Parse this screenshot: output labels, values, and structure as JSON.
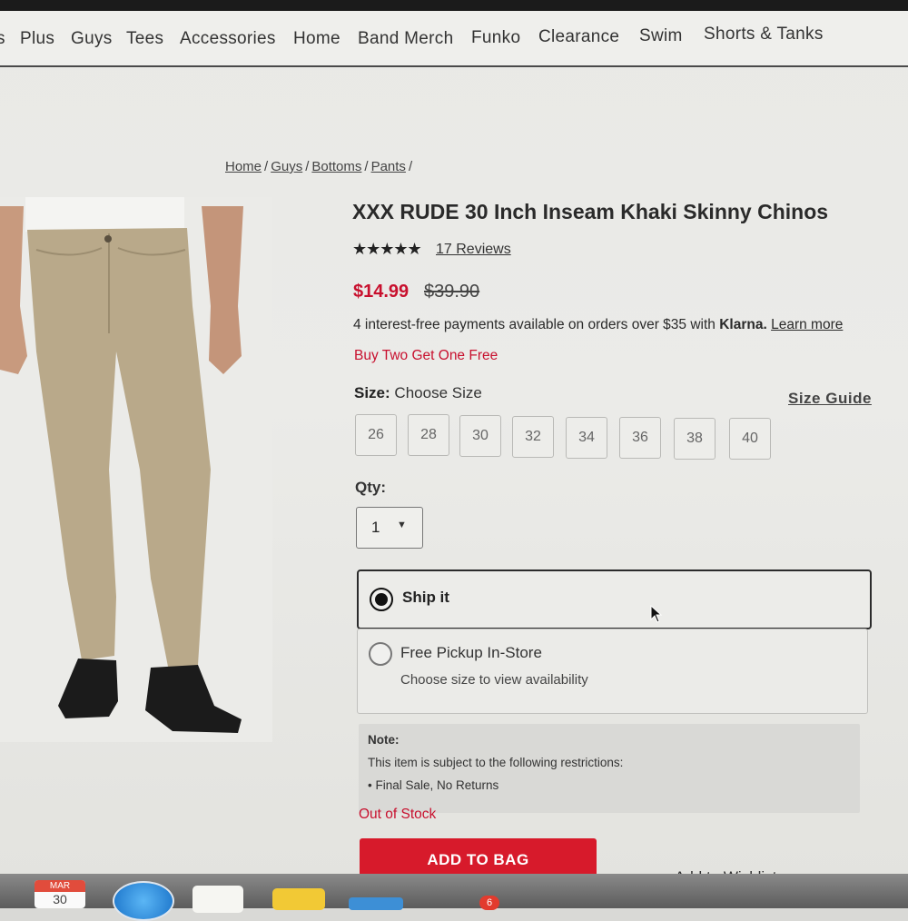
{
  "nav": {
    "items": [
      "Plus",
      "Guys",
      "Tees",
      "Accessories",
      "Home",
      "Band Merch",
      "Funko",
      "Clearance",
      "Swim",
      "Shorts & Tanks"
    ]
  },
  "breadcrumb": [
    "Home",
    "Guys",
    "Bottoms",
    "Pants"
  ],
  "product": {
    "title": "XXX RUDE 30 Inch Inseam Khaki Skinny Chinos",
    "stars": "★★★★★",
    "rating": 5,
    "reviews": "17 Reviews",
    "price_sale": "$14.99",
    "price_original": "$39.90",
    "klarna_text": "4 interest-free payments available on orders over $35 with",
    "klarna_brand": "Klarna.",
    "klarna_link": "Learn more",
    "promo": "Buy Two Get One Free"
  },
  "size": {
    "label": "Size:",
    "value": "Choose Size",
    "guide": "Size Guide",
    "options": [
      "26",
      "28",
      "30",
      "32",
      "34",
      "36",
      "38",
      "40"
    ]
  },
  "qty": {
    "label": "Qty:",
    "value": "1"
  },
  "fulfillment": {
    "ship_label": "Ship it",
    "pickup_label": "Free Pickup In-Store",
    "pickup_sub": "Choose size to view availability"
  },
  "note": {
    "title": "Note:",
    "text": "This item is subject to the following restrictions:",
    "bullet": "• Final Sale, No Returns"
  },
  "stock_status": "Out of Stock",
  "actions": {
    "add_to_bag": "ADD TO BAG",
    "wishlist": "Add to Wishlist"
  },
  "dock": {
    "calendar_month": "MAR",
    "calendar_day": "30",
    "badge": "6"
  },
  "colors": {
    "accent": "#d71a2b",
    "sale": "#c8102e"
  }
}
